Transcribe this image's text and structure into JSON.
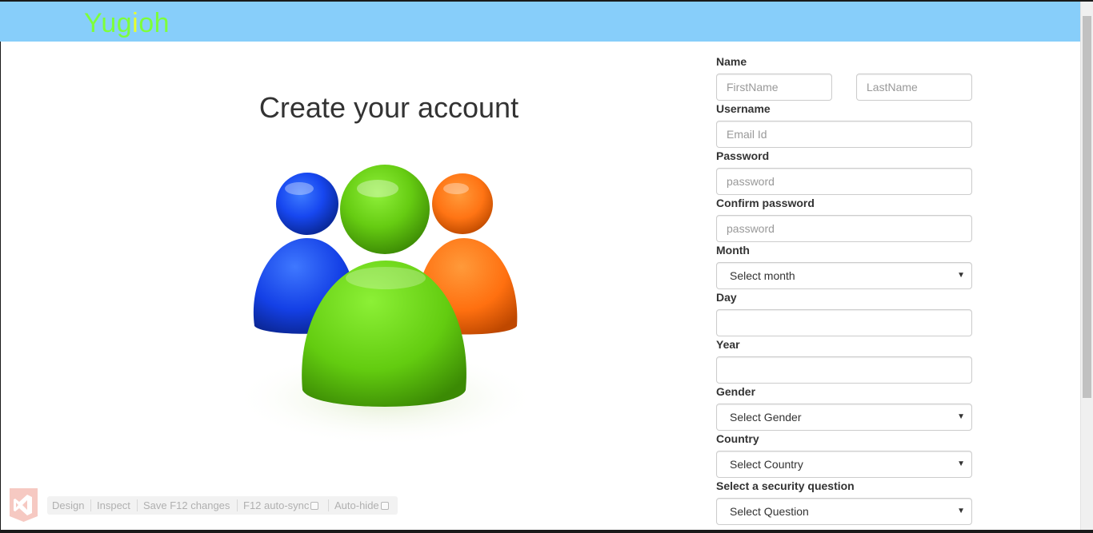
{
  "navbar": {
    "brand": {
      "letters": [
        "Y",
        "u",
        "g",
        "i",
        "o",
        "h"
      ]
    },
    "colors": {
      "background": "#87cefa",
      "brand_green": "#7dff3a",
      "brand_yellow": "#e8ff2a"
    }
  },
  "hero": {
    "title": "Create your account",
    "image": "users-group-icon"
  },
  "form": {
    "name": {
      "label": "Name",
      "first_placeholder": "FirstName",
      "last_placeholder": "LastName"
    },
    "username": {
      "label": "Username",
      "placeholder": "Email Id"
    },
    "password": {
      "label": "Password",
      "placeholder": "password"
    },
    "confirm_password": {
      "label": "Confirm password",
      "placeholder": "password"
    },
    "month": {
      "label": "Month",
      "selected": "Select month"
    },
    "day": {
      "label": "Day",
      "value": ""
    },
    "year": {
      "label": "Year",
      "value": ""
    },
    "gender": {
      "label": "Gender",
      "selected": "Select Gender"
    },
    "country": {
      "label": "Country",
      "selected": "Select Country"
    },
    "security_question": {
      "label": "Select a security question",
      "selected": "Select Question"
    }
  },
  "devtools": {
    "icon": "visual-studio-icon",
    "design": "Design",
    "inspect": "Inspect",
    "save": "Save F12 changes",
    "autosync": "F12 auto-sync",
    "autohide": "Auto-hide"
  }
}
